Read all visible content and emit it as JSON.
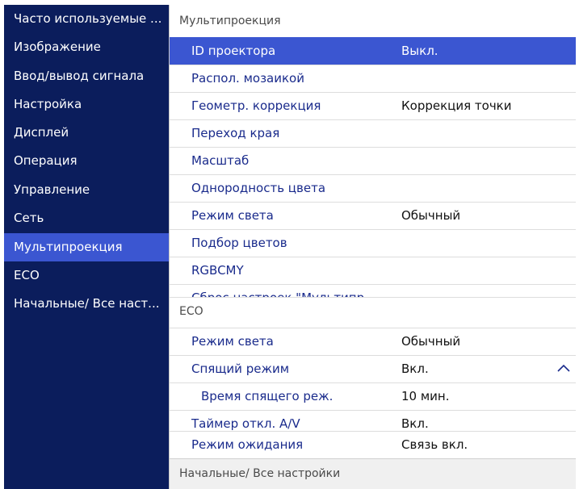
{
  "sidebar": {
    "items": [
      {
        "label": "Часто используемые ..."
      },
      {
        "label": "Изображение"
      },
      {
        "label": "Ввод/вывод сигнала"
      },
      {
        "label": "Настройка"
      },
      {
        "label": "Дисплей"
      },
      {
        "label": "Операция"
      },
      {
        "label": "Управление"
      },
      {
        "label": "Сеть"
      },
      {
        "label": "Мультипроекция"
      },
      {
        "label": "ECO"
      },
      {
        "label": "Начальные/ Все наст..."
      }
    ]
  },
  "main": {
    "multiprojection": {
      "title": "Мультипроекция",
      "rows": [
        {
          "label": "ID проектора",
          "value": "Выкл."
        },
        {
          "label": "Распол. мозаикой",
          "value": ""
        },
        {
          "label": "Геометр. коррекция",
          "value": "Коррекция точки"
        },
        {
          "label": "Переход края",
          "value": ""
        },
        {
          "label": "Масштаб",
          "value": ""
        },
        {
          "label": "Однородность цвета",
          "value": ""
        },
        {
          "label": "Режим света",
          "value": "Обычный"
        },
        {
          "label": "Подбор цветов",
          "value": ""
        },
        {
          "label": "RGBCMY",
          "value": ""
        },
        {
          "label": "Сброс настроек \"Мультипр...",
          "value": ""
        }
      ]
    },
    "eco": {
      "title": "ECO",
      "rows": [
        {
          "label": "Режим света",
          "value": "Обычный"
        },
        {
          "label": "Спящий режим",
          "value": "Вкл."
        },
        {
          "label": "Время спящего реж.",
          "value": "10 мин."
        },
        {
          "label": "Таймер откл. A/V",
          "value": "Вкл."
        },
        {
          "label": "Режим ожидания",
          "value": "Связь вкл."
        }
      ]
    },
    "footer": {
      "label": "Начальные/ Все настройки"
    }
  },
  "colors": {
    "sidebar_bg": "#0b1d5c",
    "accent": "#3b56d1",
    "label_text": "#1a2b8c"
  },
  "icons": {
    "expand": "chevron-up-icon"
  }
}
